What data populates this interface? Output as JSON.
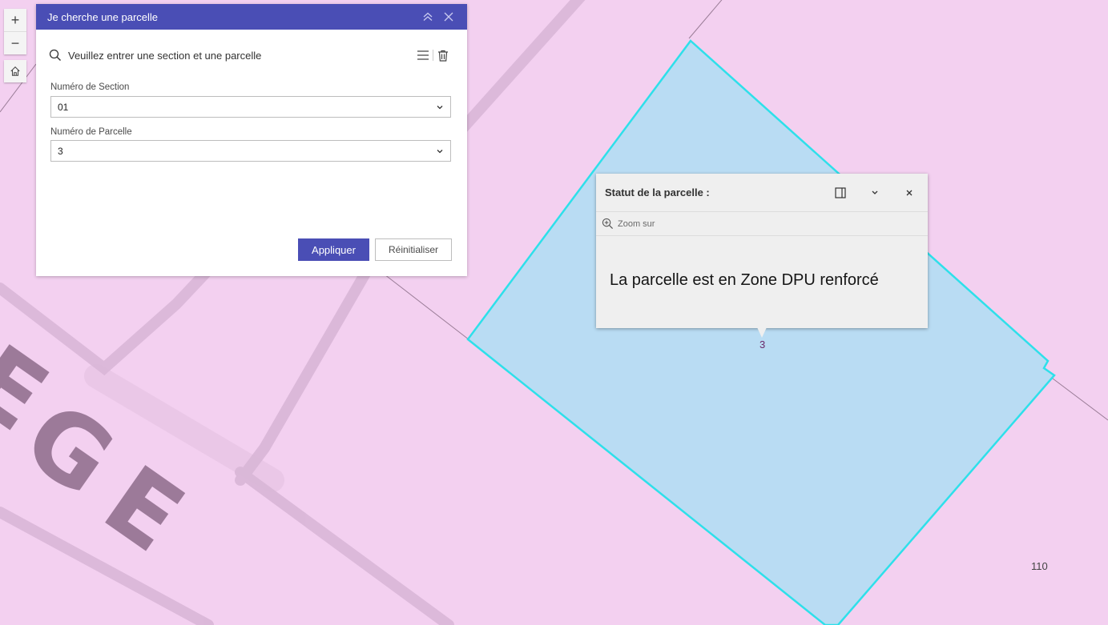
{
  "map": {
    "parcel_label": "3",
    "corner_number": "110",
    "colors": {
      "background": "#f3d0f0",
      "parcel_fill": "#b9dcf3",
      "parcel_outline": "#2ee0ea"
    }
  },
  "map_controls": {
    "zoom_in": "+",
    "zoom_out": "−"
  },
  "widget": {
    "title": "Je cherche une parcelle",
    "prompt": "Veuillez entrer une section et une parcelle",
    "section_label": "Numéro de Section",
    "section_value": "01",
    "parcel_label": "Numéro de Parcelle",
    "parcel_value": "3",
    "apply_label": "Appliquer",
    "reset_label": "Réinitialiser",
    "accent": "#4a4eb5"
  },
  "popup": {
    "title": "Statut de la parcelle :",
    "zoom_label": "Zoom sur",
    "content": "La parcelle est en Zone DPU renforcé"
  }
}
